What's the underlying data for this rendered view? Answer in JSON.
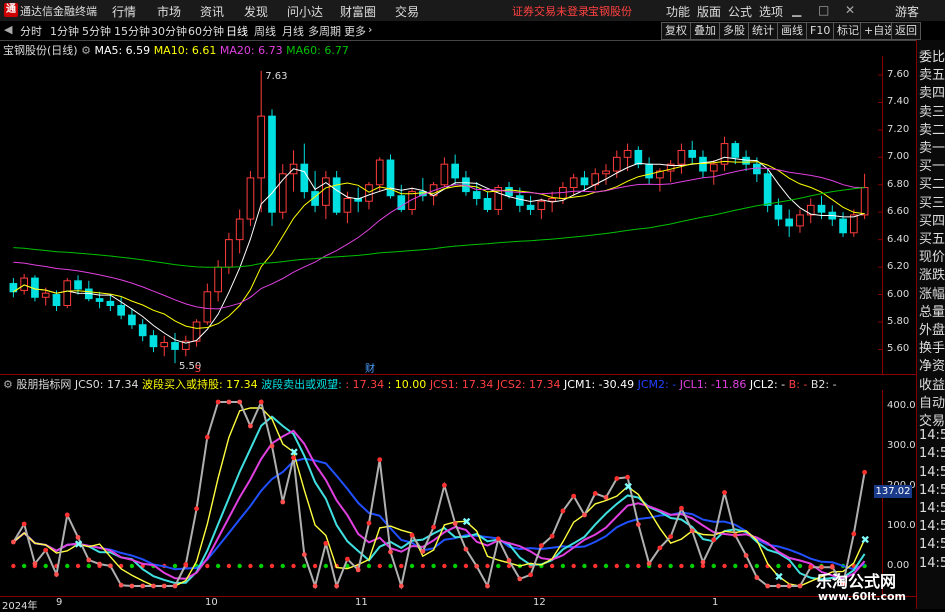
{
  "menubar": {
    "app_title": "通达信金融终端",
    "items": [
      "行情",
      "市场",
      "资讯",
      "发现",
      "问小达",
      "财富圈",
      "交易"
    ],
    "status": "证券交易未登录",
    "stock": "宝钢股份",
    "right": [
      "功能",
      "版面",
      "公式",
      "选项"
    ],
    "user": "游客"
  },
  "periods": {
    "items": [
      "分时",
      "1分钟",
      "5分钟",
      "15分钟",
      "30分钟",
      "60分钟",
      "日线",
      "周线",
      "月线",
      "多周期",
      "更多"
    ],
    "active": "日线"
  },
  "toolbar": [
    "复权",
    "叠加",
    "多股",
    "统计",
    "画线",
    "F10",
    "标记",
    "+自选",
    "返回"
  ],
  "main_info": {
    "title": "宝钢股份(日线)",
    "ma5": "MA5: 6.59",
    "ma10": "MA10: 6.61",
    "ma20": "MA20: 6.73",
    "ma60": "MA60: 6.77",
    "high_label": "7.63",
    "low_label": "5.50",
    "marker_s": "S",
    "marker_cai": "财"
  },
  "indicator_info": {
    "name": "股朋指标网",
    "jcs0": "JCS0: 17.34",
    "buy": "波段买入或持股: 17.34",
    "sell": "波段卖出或观望:",
    "v1": ": 17.34",
    "v2": ": 10.00",
    "jcs1": "JCS1: 17.34",
    "jcs2": "JCS2: 17.34",
    "jcm1": "JCM1: -30.49",
    "jcm2": "JCM2: -",
    "jcl1": "JCL1: -11.86",
    "jcl2": "JCL2: -",
    "b": "B: -",
    "b2": "B2: -"
  },
  "right_panel": [
    "委比",
    "卖五",
    "卖四",
    "卖三",
    "卖二",
    "卖一",
    "买一",
    "买二",
    "买三",
    "买四",
    "买五",
    "现价",
    "涨跌",
    "涨幅",
    "总量",
    "外盘",
    "换手",
    "净资",
    "收益",
    "自动",
    "交易",
    "14:5",
    "14:5",
    "14:5",
    "14:5",
    "14:5",
    "14:5",
    "14:5",
    "14:5"
  ],
  "price_axis": [
    "7.60",
    "7.40",
    "7.20",
    "7.00",
    "6.80",
    "6.60",
    "6.40",
    "6.20",
    "6.00",
    "5.80",
    "5.60"
  ],
  "ind_axis": [
    "400.00",
    "300.00",
    "200.00",
    "100.00",
    "0.00"
  ],
  "ind_current": "137.02",
  "x_axis": [
    "2024年",
    "9",
    "10",
    "11",
    "12",
    "1"
  ],
  "watermark": {
    "title": "乐淘公式网",
    "url": "www.60lt.com"
  },
  "colors": {
    "up": "#ff3c3c",
    "down": "#00e0e0",
    "ma5": "#ffffff",
    "ma10": "#ffff00",
    "ma20": "#e040e0",
    "ma60": "#00c000"
  },
  "chart_data": {
    "type": "candlestick",
    "ylim": [
      5.45,
      7.68
    ],
    "candles": [
      [
        6.08,
        6.12,
        5.98,
        6.02
      ],
      [
        6.03,
        6.15,
        6.0,
        6.12
      ],
      [
        6.12,
        6.14,
        5.95,
        5.98
      ],
      [
        5.98,
        6.05,
        5.92,
        6.01
      ],
      [
        6.0,
        6.03,
        5.88,
        5.92
      ],
      [
        5.92,
        6.12,
        5.9,
        6.1
      ],
      [
        6.1,
        6.14,
        6.0,
        6.04
      ],
      [
        6.04,
        6.1,
        5.95,
        5.97
      ],
      [
        5.97,
        6.02,
        5.9,
        5.95
      ],
      [
        5.95,
        6.0,
        5.88,
        5.92
      ],
      [
        5.92,
        5.98,
        5.82,
        5.85
      ],
      [
        5.85,
        5.9,
        5.75,
        5.78
      ],
      [
        5.78,
        5.82,
        5.66,
        5.7
      ],
      [
        5.7,
        5.74,
        5.58,
        5.62
      ],
      [
        5.62,
        5.7,
        5.55,
        5.65
      ],
      [
        5.65,
        5.72,
        5.5,
        5.6
      ],
      [
        5.6,
        5.7,
        5.55,
        5.66
      ],
      [
        5.66,
        5.82,
        5.62,
        5.8
      ],
      [
        5.8,
        6.08,
        5.78,
        6.02
      ],
      [
        6.02,
        6.25,
        5.95,
        6.2
      ],
      [
        6.2,
        6.45,
        6.15,
        6.4
      ],
      [
        6.4,
        6.62,
        6.3,
        6.55
      ],
      [
        6.55,
        6.9,
        6.5,
        6.85
      ],
      [
        6.85,
        7.63,
        6.6,
        7.3
      ],
      [
        7.3,
        7.35,
        6.5,
        6.6
      ],
      [
        6.6,
        6.95,
        6.55,
        6.88
      ],
      [
        6.88,
        7.05,
        6.75,
        6.95
      ],
      [
        6.95,
        7.1,
        6.7,
        6.75
      ],
      [
        6.75,
        6.9,
        6.6,
        6.65
      ],
      [
        6.65,
        6.9,
        6.55,
        6.85
      ],
      [
        6.85,
        6.9,
        6.58,
        6.6
      ],
      [
        6.6,
        6.75,
        6.52,
        6.7
      ],
      [
        6.7,
        6.78,
        6.6,
        6.68
      ],
      [
        6.68,
        6.82,
        6.62,
        6.8
      ],
      [
        6.8,
        7.0,
        6.75,
        6.98
      ],
      [
        6.98,
        7.02,
        6.7,
        6.72
      ],
      [
        6.72,
        6.8,
        6.6,
        6.62
      ],
      [
        6.62,
        6.78,
        6.58,
        6.75
      ],
      [
        6.75,
        6.85,
        6.68,
        6.72
      ],
      [
        6.72,
        6.82,
        6.65,
        6.8
      ],
      [
        6.8,
        7.0,
        6.78,
        6.95
      ],
      [
        6.95,
        7.02,
        6.8,
        6.85
      ],
      [
        6.85,
        6.9,
        6.72,
        6.75
      ],
      [
        6.75,
        6.82,
        6.65,
        6.7
      ],
      [
        6.7,
        6.75,
        6.6,
        6.62
      ],
      [
        6.62,
        6.8,
        6.58,
        6.78
      ],
      [
        6.78,
        6.82,
        6.7,
        6.72
      ],
      [
        6.72,
        6.78,
        6.6,
        6.65
      ],
      [
        6.65,
        6.72,
        6.58,
        6.62
      ],
      [
        6.62,
        6.7,
        6.55,
        6.68
      ],
      [
        6.68,
        6.75,
        6.6,
        6.7
      ],
      [
        6.7,
        6.82,
        6.66,
        6.78
      ],
      [
        6.78,
        6.88,
        6.72,
        6.85
      ],
      [
        6.85,
        6.9,
        6.75,
        6.8
      ],
      [
        6.8,
        6.92,
        6.76,
        6.88
      ],
      [
        6.88,
        6.95,
        6.8,
        6.9
      ],
      [
        6.9,
        7.05,
        6.85,
        7.0
      ],
      [
        7.0,
        7.1,
        6.9,
        7.05
      ],
      [
        7.05,
        7.08,
        6.92,
        6.95
      ],
      [
        6.95,
        7.0,
        6.8,
        6.85
      ],
      [
        6.85,
        6.92,
        6.75,
        6.9
      ],
      [
        6.9,
        6.98,
        6.82,
        6.95
      ],
      [
        6.95,
        7.1,
        6.88,
        7.05
      ],
      [
        7.05,
        7.12,
        6.95,
        7.0
      ],
      [
        7.0,
        7.05,
        6.85,
        6.9
      ],
      [
        6.9,
        6.98,
        6.8,
        6.95
      ],
      [
        6.95,
        7.15,
        6.9,
        7.1
      ],
      [
        7.1,
        7.12,
        6.95,
        7.0
      ],
      [
        7.0,
        7.05,
        6.9,
        6.95
      ],
      [
        6.95,
        7.0,
        6.82,
        6.88
      ],
      [
        6.88,
        6.92,
        6.6,
        6.65
      ],
      [
        6.65,
        6.7,
        6.5,
        6.55
      ],
      [
        6.55,
        6.62,
        6.42,
        6.5
      ],
      [
        6.5,
        6.62,
        6.45,
        6.58
      ],
      [
        6.58,
        6.7,
        6.52,
        6.65
      ],
      [
        6.65,
        6.72,
        6.55,
        6.6
      ],
      [
        6.6,
        6.65,
        6.5,
        6.55
      ],
      [
        6.55,
        6.6,
        6.42,
        6.45
      ],
      [
        6.45,
        6.62,
        6.42,
        6.58
      ],
      [
        6.58,
        6.88,
        6.55,
        6.78
      ]
    ]
  }
}
